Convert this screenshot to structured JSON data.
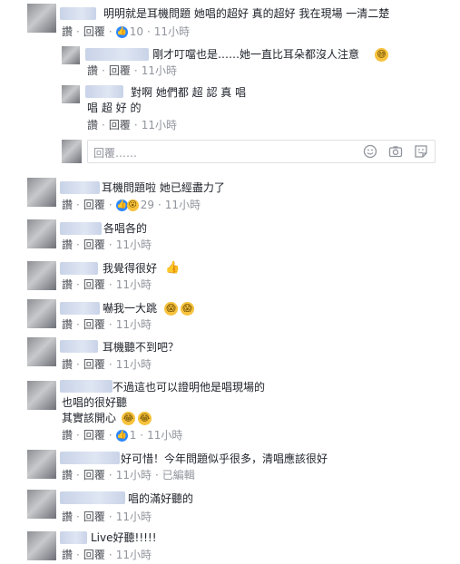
{
  "ui": {
    "like": "讚",
    "reply": "回覆",
    "sep": "·",
    "edited": "已編輯",
    "reply_placeholder": "回覆……"
  },
  "comments": [
    {
      "text": "明明就是耳機問題 她唱的超好 真的超好 我在現場 一清二楚",
      "likes": "10",
      "time": "11小時"
    },
    {
      "text": "剛才叮噹也是……她一直比耳朵都沒人注意",
      "time": "11小時"
    },
    {
      "text_line1": "對啊 她們都 超 認 真 唱",
      "text_line2": "唱 超 好 的",
      "time": "11小時"
    },
    {
      "text": "耳機問題啦 她已經盡力了",
      "likes": "29",
      "time": "11小時"
    },
    {
      "text": "各唱各的",
      "time": "11小時"
    },
    {
      "text": "我覺得很好",
      "time": "11小時"
    },
    {
      "text": "嚇我一大跳",
      "time": "11小時"
    },
    {
      "text": "耳機聽不到吧？",
      "time": "11小時"
    },
    {
      "text_line1": "不過這也可以證明他是唱現場的",
      "text_line2": "也唱的很好聽",
      "text_line3": "其實該開心",
      "likes": "1",
      "time": "11小時"
    },
    {
      "text": "好可惜！今年問題似乎很多，清唱應該很好",
      "time": "11小時"
    },
    {
      "text": "唱的滿好聽的",
      "time": "11小時"
    },
    {
      "text": "Live好聽!!!!!",
      "time": "11小時"
    }
  ],
  "icons": {
    "smile": "smile-icon",
    "camera": "camera-icon",
    "sticker": "sticker-icon"
  }
}
